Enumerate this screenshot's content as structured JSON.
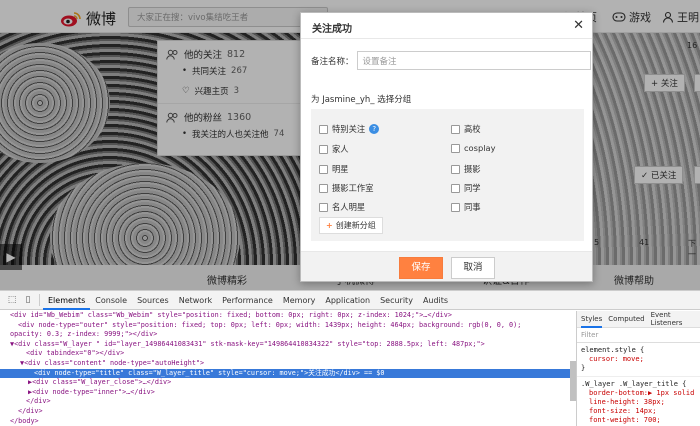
{
  "topbar": {
    "logo_text": "微博",
    "search_placeholder": "大家正在搜：vivo集结吃王者",
    "nav": [
      {
        "label": "首页"
      },
      {
        "label": "游戏"
      },
      {
        "label": "王明"
      }
    ]
  },
  "follow_popup": {
    "following_label": "他的关注",
    "following_count": "812",
    "mutual_label": "共同关注",
    "mutual_count": "267",
    "interest_label": "兴趣主页",
    "interest_count": "3",
    "fans_label": "他的粉丝",
    "fans_count": "1360",
    "known_label": "我关注的人也关注他",
    "known_count": "74"
  },
  "right_side": {
    "follow_btn": "+ 关注",
    "followed_btn": "✓ 已关注",
    "pager_page": "5",
    "pager_last": "41",
    "pager_next": "下一",
    "number_hint": "16"
  },
  "bottom_nav": {
    "items": [
      "微博精彩",
      "手机微博",
      "认证&合作",
      "微博帮助"
    ]
  },
  "dialog": {
    "title": "关注成功",
    "remark_label": "备注名称：",
    "remark_placeholder": "设置备注",
    "group_title": "为 Jasmine_yh_ 选择分组",
    "groups": [
      "特别关注",
      "高校",
      "家人",
      "cosplay",
      "明星",
      "摄影",
      "摄影工作室",
      "同学",
      "名人明星",
      "同事"
    ],
    "new_group": "创建新分组",
    "save": "保存",
    "cancel": "取消"
  },
  "devtools": {
    "tabs": [
      "Elements",
      "Console",
      "Sources",
      "Network",
      "Performance",
      "Memory",
      "Application",
      "Security",
      "Audits"
    ],
    "lines": [
      "<div id=\"Wb_Webim\" class=\"Wb_Webim\" style=\"position: fixed; bottom: 0px; right: 0px; z-index: 1024;\">…</div>",
      "<div node-type=\"outer\" style=\"position: fixed; top: 0px; left: 0px; width: 1439px; height: 464px; background: rgb(0, 0, 0);",
      "opacity: 0.3; z-index: 9999;\"></div>",
      "▼<div class=\"W_layer \" id=\"layer_14986441083431\" stk-mask-key=\"149864410834322\" style=\"top: 2888.5px; left: 487px;\">",
      "<div tabindex=\"0\"></div>",
      "▼<div class=\"content\" node-type=\"autoHeight\">",
      "<div node-type=\"title\" class=\"W_layer_title\" style=\"cursor: move;\">关注成功</div> == $0",
      "▶<div class=\"W_layer_close\">…</div>",
      "▶<div node-type=\"inner\">…</div>",
      "</div>",
      "</div>",
      "</body>"
    ],
    "styles_tabs": [
      "Styles",
      "Computed",
      "Event Listeners"
    ],
    "filter": "Filter",
    "element_style_selector": "element.style {",
    "element_style_prop": "cursor: move;",
    "close_brace": "}",
    "rule_selector": ".W_layer .W_layer_title {",
    "rule_props": [
      "border-bottom:▶ 1px solid",
      "line-height: 38px;",
      "font-size: 14px;",
      "font-weight: 700;"
    ]
  }
}
